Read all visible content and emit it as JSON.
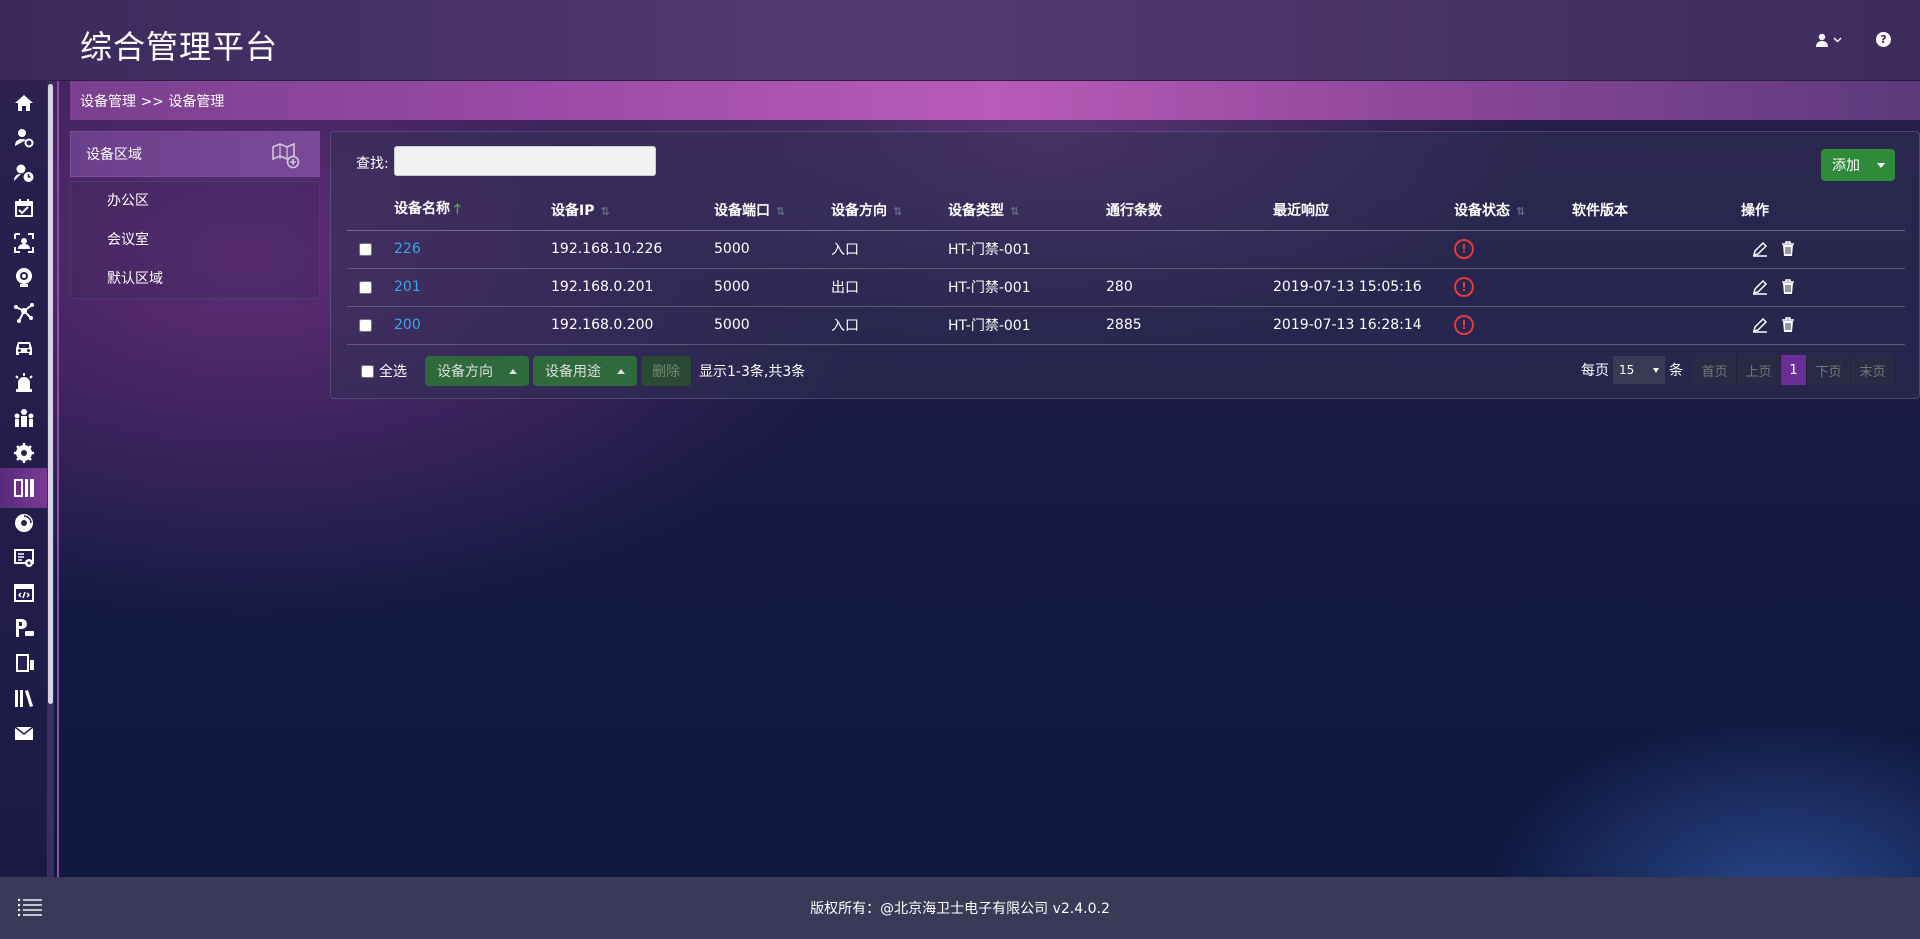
{
  "app": {
    "title": "综合管理平台"
  },
  "breadcrumb": "设备管理 >> 设备管理",
  "rail": {
    "icons": [
      "home-icon",
      "user-settings-icon",
      "user-clock-icon",
      "calendar-icon",
      "id-card-icon",
      "camera-icon",
      "network-icon",
      "car-icon",
      "alarm-icon",
      "group-icon",
      "settings-gear-icon",
      "door-access-icon",
      "disc-icon",
      "server-settings-icon",
      "code-window-icon",
      "parking-icon",
      "door-icon",
      "books-icon",
      "mail-icon"
    ],
    "active_index": 11
  },
  "area": {
    "title": "设备区域",
    "items": [
      "办公区",
      "会议室",
      "默认区域"
    ]
  },
  "search": {
    "label": "查找:",
    "value": "",
    "placeholder": ""
  },
  "toolbar": {
    "add_label": "添加"
  },
  "table": {
    "headers": [
      "设备名称",
      "设备IP",
      "设备端口",
      "设备方向",
      "设备类型",
      "通行条数",
      "最近响应",
      "设备状态",
      "软件版本",
      "操作"
    ],
    "rows": [
      {
        "name": "226",
        "ip": "192.168.10.226",
        "port": "5000",
        "direction": "入口",
        "type": "HT-门禁-001",
        "count": "",
        "last": "",
        "version": ""
      },
      {
        "name": "201",
        "ip": "192.168.0.201",
        "port": "5000",
        "direction": "出口",
        "type": "HT-门禁-001",
        "count": "280",
        "last": "2019-07-13 15:05:16",
        "version": ""
      },
      {
        "name": "200",
        "ip": "192.168.0.200",
        "port": "5000",
        "direction": "入口",
        "type": "HT-门禁-001",
        "count": "2885",
        "last": "2019-07-13 16:28:14",
        "version": ""
      }
    ]
  },
  "bottom": {
    "select_all": "全选",
    "direction_btn": "设备方向",
    "usage_btn": "设备用途",
    "delete_btn": "删除",
    "summary": "显示1-3条,共3条"
  },
  "pager": {
    "per_page_label": "每页",
    "per_page_value": "15",
    "unit": "条",
    "first": "首页",
    "prev": "上页",
    "current": "1",
    "next": "下页",
    "last": "末页"
  },
  "footer": {
    "text": "版权所有：@北京海卫士电子有限公司 v2.4.0.2"
  },
  "colors": {
    "accent_green": "#2f8a3a",
    "link_blue": "#3aa6e8",
    "status_red": "#e03b3b",
    "active_purple": "#6a2f96"
  }
}
